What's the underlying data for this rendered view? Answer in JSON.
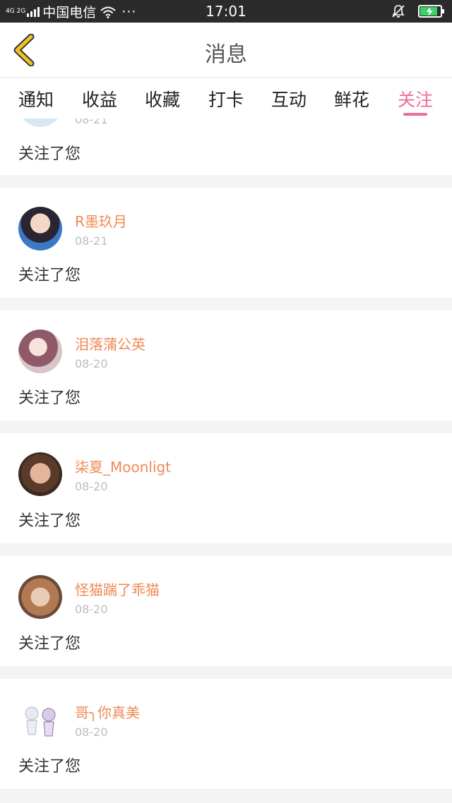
{
  "status_bar": {
    "network": "4G 2G",
    "carrier": "中国电信",
    "more": "···",
    "time": "17:01"
  },
  "header": {
    "title": "消息"
  },
  "tabs": [
    {
      "label": "通知"
    },
    {
      "label": "收益"
    },
    {
      "label": "收藏"
    },
    {
      "label": "打卡"
    },
    {
      "label": "互动"
    },
    {
      "label": "鲜花"
    },
    {
      "label": "关注",
      "active": true
    }
  ],
  "partial_item": {
    "date": "08-21",
    "message": "关注了您"
  },
  "items": [
    {
      "username": "R墨玖月",
      "date": "08-21",
      "message": "关注了您"
    },
    {
      "username": "泪落蒲公英",
      "date": "08-20",
      "message": "关注了您"
    },
    {
      "username": "柒夏_Moonligt",
      "date": "08-20",
      "message": "关注了您"
    },
    {
      "username": "怪猫踹了乖猫",
      "date": "08-20",
      "message": "关注了您"
    },
    {
      "username": "哥╮你真美",
      "date": "08-20",
      "message": "关注了您"
    }
  ],
  "colors": {
    "accent": "#ee6c9a",
    "username": "#f08a55",
    "back_icon": "#f0c420",
    "status_bar": "#2b2b2b"
  }
}
